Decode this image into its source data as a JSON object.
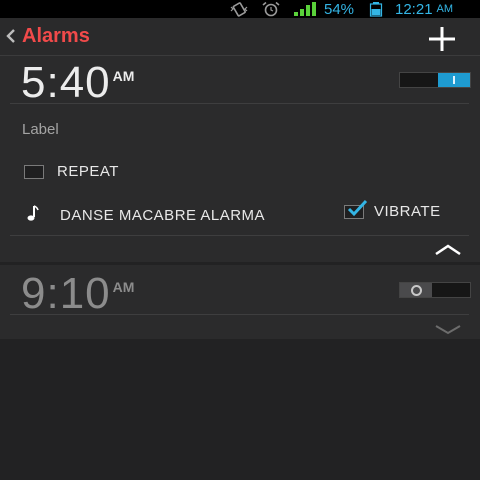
{
  "status_bar": {
    "battery_percent": "54%",
    "time": "12:21",
    "time_ampm": "AM",
    "icons": [
      "vibrate-icon",
      "alarm-clock-icon",
      "signal-icon",
      "battery-icon"
    ],
    "accent_color": "#33b5e5"
  },
  "action_bar": {
    "title": "Alarms",
    "title_color": "#f14a4a",
    "back_icon": "chevron-left-icon",
    "add_icon": "plus-icon"
  },
  "alarms": [
    {
      "time": "5:40",
      "ampm": "AM",
      "enabled": true,
      "expanded": true,
      "label": "Label",
      "repeat_label": "REPEAT",
      "repeat_checked": false,
      "ringtone": "DANSE MACABRE ALARMA",
      "vibrate_label": "VIBRATE",
      "vibrate_checked": true,
      "toggle_color": "#1e9bd1"
    },
    {
      "time": "9:10",
      "ampm": "AM",
      "enabled": false,
      "expanded": false
    }
  ]
}
